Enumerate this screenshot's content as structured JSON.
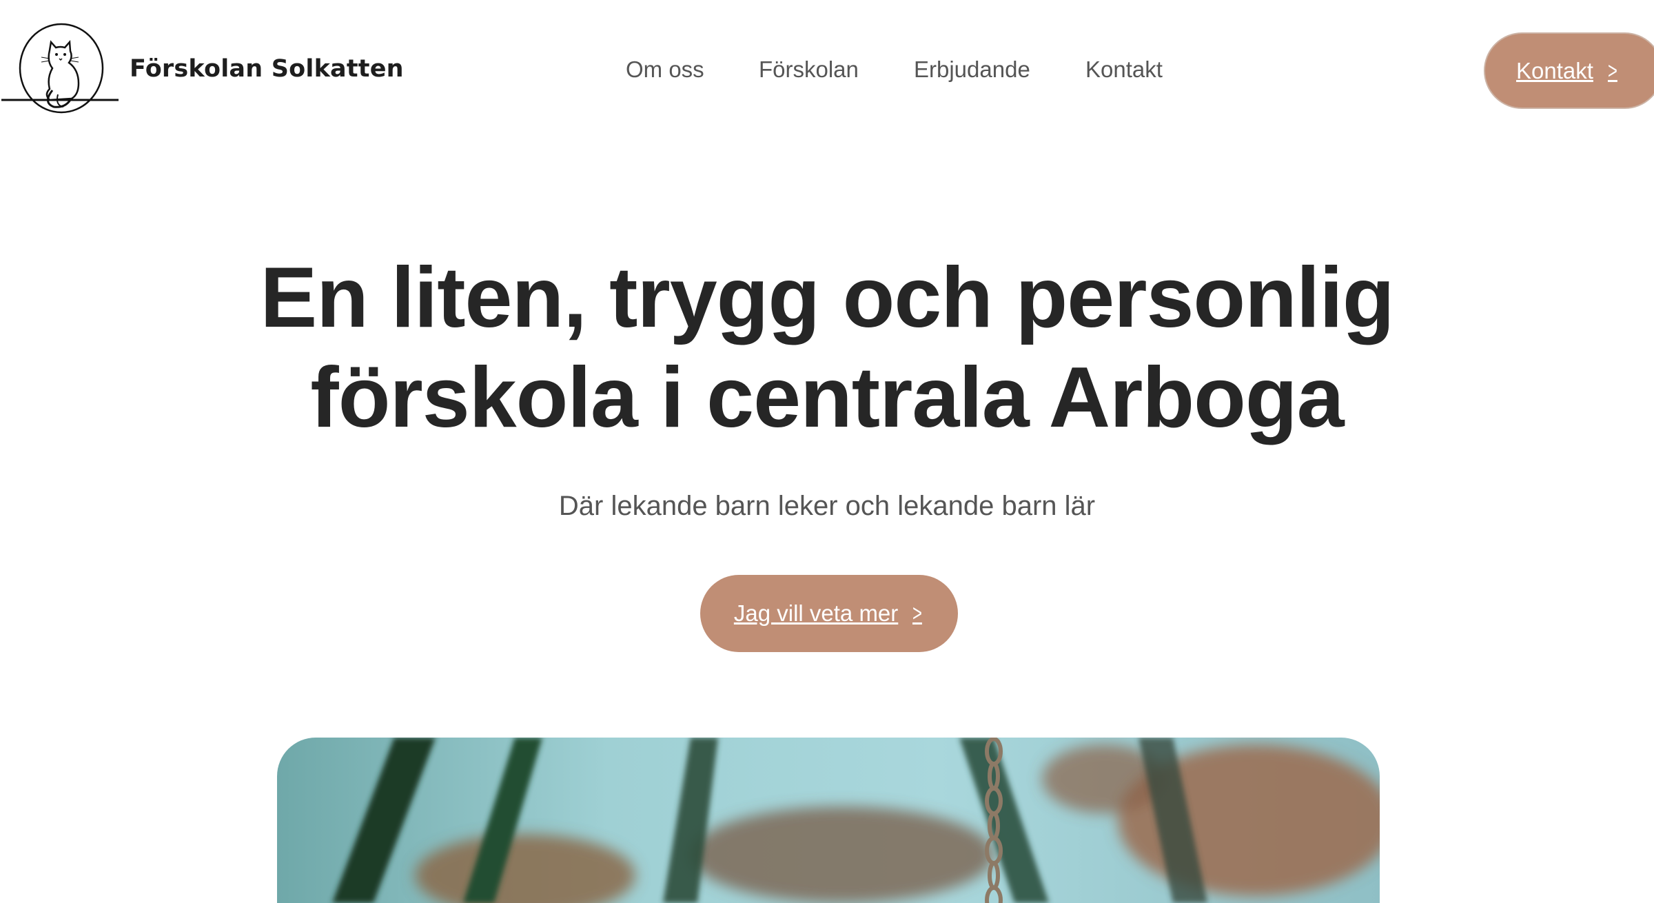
{
  "header": {
    "brand_name": "Förskolan Solkatten",
    "logo_icon": "cat-sun-logo",
    "nav": [
      "Om oss",
      "Förskolan",
      "Erbjudande",
      "Kontakt"
    ],
    "cta_label": "Kontakt"
  },
  "hero": {
    "title_line1": "En liten, trygg och personlig",
    "title_line2": "förskola i centrala Arboga",
    "subtitle": "Där lekande barn leker och lekande barn lär",
    "cta_label": "Jag vill veta mer",
    "image_icon": "playground-swing-photo"
  },
  "colors": {
    "accent": "#c08e75",
    "text_dark": "#262626",
    "text_muted": "#555555",
    "background": "#ffffff"
  }
}
